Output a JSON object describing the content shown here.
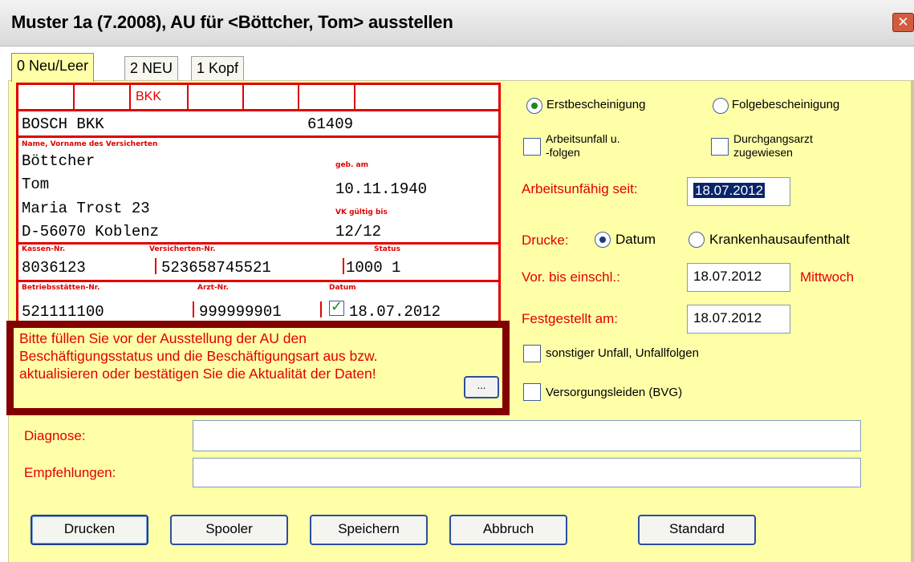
{
  "window": {
    "title": "Muster 1a (7.2008), AU für <Böttcher, Tom> ausstellen",
    "close_icon": "close-icon"
  },
  "tabs": [
    {
      "label": "0 Neu/Leer",
      "active": true
    },
    {
      "label": "2 NEU",
      "active": false
    },
    {
      "label": "1 Kopf",
      "active": false
    }
  ],
  "form": {
    "kassenart": "BKK",
    "krankenkasse": "BOSCH BKK",
    "kassen_code": "61409",
    "name_label": "Name, Vorname des Versicherten",
    "nachname": "Böttcher",
    "vorname": "Tom",
    "strasse": "Maria Trost 23",
    "ort": "D-56070 Koblenz",
    "geb_label": "geb. am",
    "geb_datum": "10.11.1940",
    "vk_label": "VK gültig bis",
    "vk_gueltig": "12/12",
    "kassen_nr_label": "Kassen-Nr.",
    "kassen_nr": "8036123",
    "versicherten_nr_label": "Versicherten-Nr.",
    "versicherten_nr": "523658745521",
    "status_label": "Status",
    "status": "1000 1",
    "betriebsstaetten_label": "Betriebsstätten-Nr.",
    "betriebsstaetten_nr": "521111100",
    "arzt_label": "Arzt-Nr.",
    "arzt_nr": "999999901",
    "datum_label": "Datum",
    "datum": "18.07.2012",
    "datum_checked": true
  },
  "warning": {
    "line1": "Bitte füllen Sie vor der Ausstellung der AU den",
    "line2": "Beschäftigungsstatus und die Beschäftigungsart aus bzw.",
    "line3": "aktualisieren oder bestätigen Sie die Aktualität der Daten!",
    "more_button": "..."
  },
  "options": {
    "erstbescheinigung": "Erstbescheinigung",
    "erstbescheinigung_selected": true,
    "folgebescheinigung": "Folgebescheinigung",
    "arbeitsunfall_line1": "Arbeitsunfall u.",
    "arbeitsunfall_line2": "-folgen",
    "durchgangsarzt_line1": "Durchgangsarzt",
    "durchgangsarzt_line2": "zugewiesen",
    "arbeitsunfaehig_label": "Arbeitsunfähig seit:",
    "arbeitsunfaehig_value": "18.07.2012",
    "drucke_label": "Drucke:",
    "drucke_datum": "Datum",
    "drucke_datum_selected": true,
    "drucke_krankenhaus": "Krankenhausaufenthalt",
    "vor_bis_label": "Vor. bis einschl.:",
    "vor_bis_value": "18.07.2012",
    "vor_bis_weekday": "Mittwoch",
    "festgestellt_label": "Festgestellt am:",
    "festgestellt_value": "18.07.2012",
    "sonstiger_unfall": "sonstiger Unfall, Unfallfolgen",
    "versorgungsleiden": "Versorgungsleiden (BVG)"
  },
  "bottom": {
    "diagnose_label": "Diagnose:",
    "diagnose_value": "",
    "empfehlungen_label": "Empfehlungen:",
    "empfehlungen_value": ""
  },
  "buttons": {
    "drucken": "Drucken",
    "spooler": "Spooler",
    "speichern": "Speichern",
    "abbruch": "Abbruch",
    "standard": "Standard"
  },
  "colors": {
    "panel": "#ffffa8",
    "form_red": "#e00000",
    "warning_border": "#820000"
  }
}
